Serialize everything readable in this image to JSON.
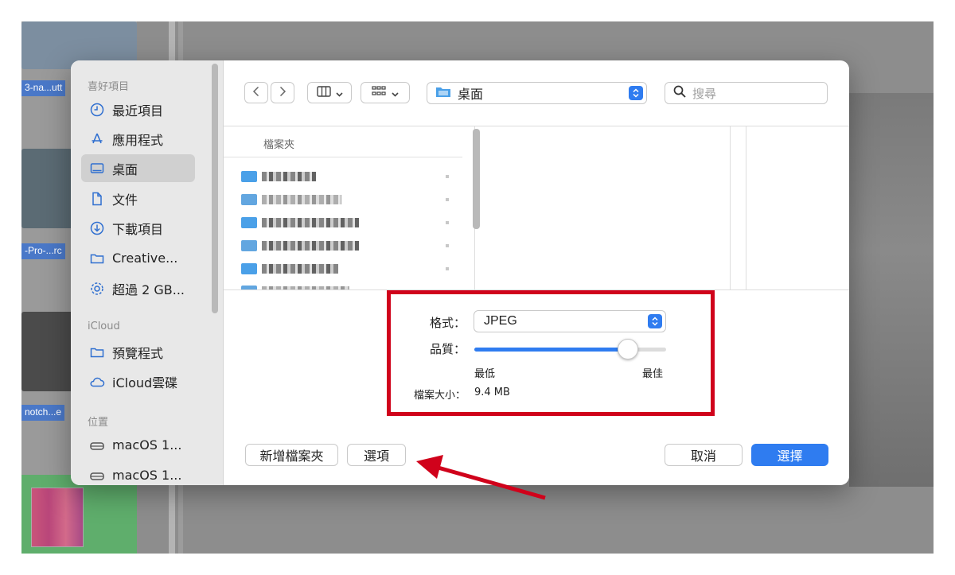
{
  "background": {
    "thumb_labels": [
      "3-na...utt",
      "-Pro-...rc",
      "notch...e"
    ]
  },
  "sidebar": {
    "sections": [
      {
        "title": "喜好項目"
      },
      {
        "title": "iCloud"
      },
      {
        "title": "位置"
      }
    ],
    "favorites": [
      {
        "label": "最近項目",
        "icon": "clock-icon"
      },
      {
        "label": "應用程式",
        "icon": "apps-icon"
      },
      {
        "label": "桌面",
        "icon": "desktop-icon",
        "selected": true
      },
      {
        "label": "文件",
        "icon": "document-icon"
      },
      {
        "label": "下載項目",
        "icon": "download-icon"
      },
      {
        "label": "Creative...",
        "icon": "folder-icon"
      },
      {
        "label": "超過 2 GB...",
        "icon": "gear-icon"
      }
    ],
    "icloud": [
      {
        "label": "預覽程式",
        "icon": "folder-icon"
      },
      {
        "label": "iCloud雲碟",
        "icon": "cloud-icon"
      }
    ],
    "locations": [
      {
        "label": "macOS 1...",
        "icon": "disk-icon"
      },
      {
        "label": "macOS 1...",
        "icon": "disk-icon"
      }
    ]
  },
  "toolbar": {
    "location": "桌面",
    "search_placeholder": "搜尋"
  },
  "browser": {
    "column_header": "檔案夾"
  },
  "options": {
    "format_label": "格式：",
    "format_value": "JPEG",
    "quality_label": "品質：",
    "quality_level": 0.8,
    "min_label": "最低",
    "max_label": "最佳",
    "filesize_label": "檔案大小：",
    "filesize_value": "9.4 MB"
  },
  "buttons": {
    "new_folder": "新增檔案夾",
    "options": "選項",
    "cancel": "取消",
    "choose": "選擇"
  },
  "colors": {
    "accent": "#2f7cf0",
    "highlight": "#d0021b"
  }
}
